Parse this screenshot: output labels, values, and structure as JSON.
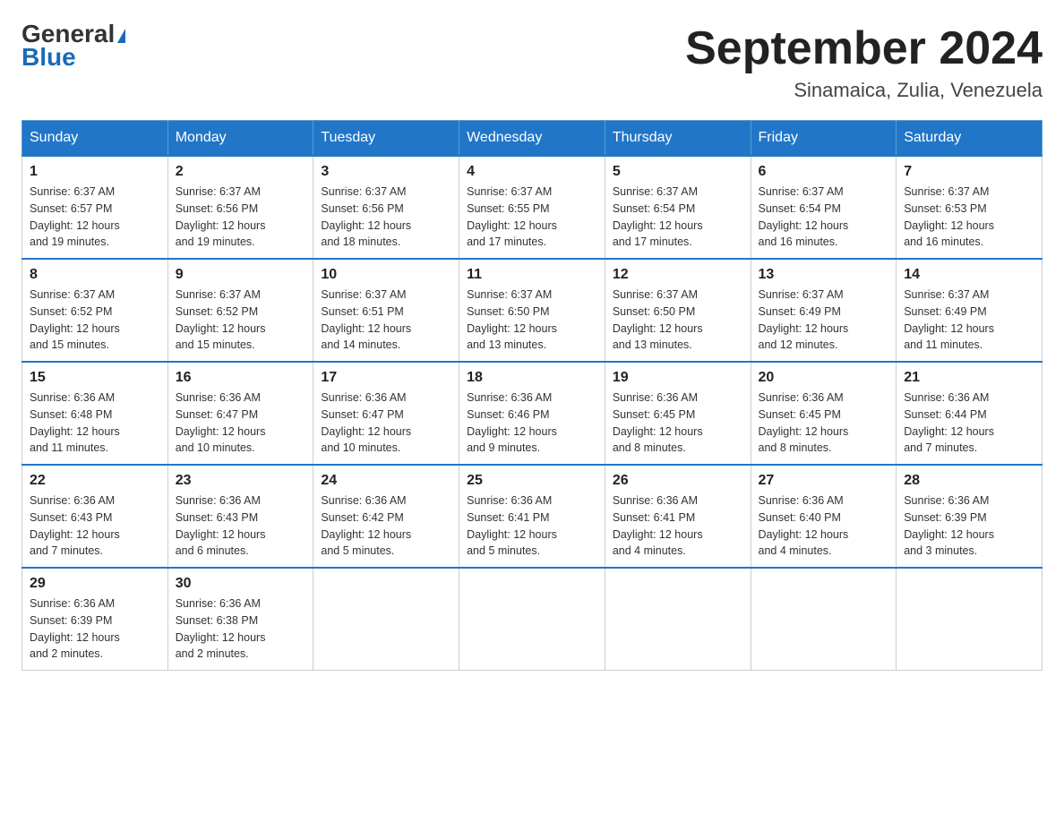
{
  "header": {
    "logo_general": "General",
    "logo_blue": "Blue",
    "month_year": "September 2024",
    "location": "Sinamaica, Zulia, Venezuela"
  },
  "days_of_week": [
    "Sunday",
    "Monday",
    "Tuesday",
    "Wednesday",
    "Thursday",
    "Friday",
    "Saturday"
  ],
  "weeks": [
    [
      {
        "day": "1",
        "sunrise": "6:37 AM",
        "sunset": "6:57 PM",
        "daylight": "12 hours and 19 minutes."
      },
      {
        "day": "2",
        "sunrise": "6:37 AM",
        "sunset": "6:56 PM",
        "daylight": "12 hours and 19 minutes."
      },
      {
        "day": "3",
        "sunrise": "6:37 AM",
        "sunset": "6:56 PM",
        "daylight": "12 hours and 18 minutes."
      },
      {
        "day": "4",
        "sunrise": "6:37 AM",
        "sunset": "6:55 PM",
        "daylight": "12 hours and 17 minutes."
      },
      {
        "day": "5",
        "sunrise": "6:37 AM",
        "sunset": "6:54 PM",
        "daylight": "12 hours and 17 minutes."
      },
      {
        "day": "6",
        "sunrise": "6:37 AM",
        "sunset": "6:54 PM",
        "daylight": "12 hours and 16 minutes."
      },
      {
        "day": "7",
        "sunrise": "6:37 AM",
        "sunset": "6:53 PM",
        "daylight": "12 hours and 16 minutes."
      }
    ],
    [
      {
        "day": "8",
        "sunrise": "6:37 AM",
        "sunset": "6:52 PM",
        "daylight": "12 hours and 15 minutes."
      },
      {
        "day": "9",
        "sunrise": "6:37 AM",
        "sunset": "6:52 PM",
        "daylight": "12 hours and 15 minutes."
      },
      {
        "day": "10",
        "sunrise": "6:37 AM",
        "sunset": "6:51 PM",
        "daylight": "12 hours and 14 minutes."
      },
      {
        "day": "11",
        "sunrise": "6:37 AM",
        "sunset": "6:50 PM",
        "daylight": "12 hours and 13 minutes."
      },
      {
        "day": "12",
        "sunrise": "6:37 AM",
        "sunset": "6:50 PM",
        "daylight": "12 hours and 13 minutes."
      },
      {
        "day": "13",
        "sunrise": "6:37 AM",
        "sunset": "6:49 PM",
        "daylight": "12 hours and 12 minutes."
      },
      {
        "day": "14",
        "sunrise": "6:37 AM",
        "sunset": "6:49 PM",
        "daylight": "12 hours and 11 minutes."
      }
    ],
    [
      {
        "day": "15",
        "sunrise": "6:36 AM",
        "sunset": "6:48 PM",
        "daylight": "12 hours and 11 minutes."
      },
      {
        "day": "16",
        "sunrise": "6:36 AM",
        "sunset": "6:47 PM",
        "daylight": "12 hours and 10 minutes."
      },
      {
        "day": "17",
        "sunrise": "6:36 AM",
        "sunset": "6:47 PM",
        "daylight": "12 hours and 10 minutes."
      },
      {
        "day": "18",
        "sunrise": "6:36 AM",
        "sunset": "6:46 PM",
        "daylight": "12 hours and 9 minutes."
      },
      {
        "day": "19",
        "sunrise": "6:36 AM",
        "sunset": "6:45 PM",
        "daylight": "12 hours and 8 minutes."
      },
      {
        "day": "20",
        "sunrise": "6:36 AM",
        "sunset": "6:45 PM",
        "daylight": "12 hours and 8 minutes."
      },
      {
        "day": "21",
        "sunrise": "6:36 AM",
        "sunset": "6:44 PM",
        "daylight": "12 hours and 7 minutes."
      }
    ],
    [
      {
        "day": "22",
        "sunrise": "6:36 AM",
        "sunset": "6:43 PM",
        "daylight": "12 hours and 7 minutes."
      },
      {
        "day": "23",
        "sunrise": "6:36 AM",
        "sunset": "6:43 PM",
        "daylight": "12 hours and 6 minutes."
      },
      {
        "day": "24",
        "sunrise": "6:36 AM",
        "sunset": "6:42 PM",
        "daylight": "12 hours and 5 minutes."
      },
      {
        "day": "25",
        "sunrise": "6:36 AM",
        "sunset": "6:41 PM",
        "daylight": "12 hours and 5 minutes."
      },
      {
        "day": "26",
        "sunrise": "6:36 AM",
        "sunset": "6:41 PM",
        "daylight": "12 hours and 4 minutes."
      },
      {
        "day": "27",
        "sunrise": "6:36 AM",
        "sunset": "6:40 PM",
        "daylight": "12 hours and 4 minutes."
      },
      {
        "day": "28",
        "sunrise": "6:36 AM",
        "sunset": "6:39 PM",
        "daylight": "12 hours and 3 minutes."
      }
    ],
    [
      {
        "day": "29",
        "sunrise": "6:36 AM",
        "sunset": "6:39 PM",
        "daylight": "12 hours and 2 minutes."
      },
      {
        "day": "30",
        "sunrise": "6:36 AM",
        "sunset": "6:38 PM",
        "daylight": "12 hours and 2 minutes."
      },
      null,
      null,
      null,
      null,
      null
    ]
  ],
  "labels": {
    "sunrise_prefix": "Sunrise: ",
    "sunset_prefix": "Sunset: ",
    "daylight_prefix": "Daylight: "
  }
}
